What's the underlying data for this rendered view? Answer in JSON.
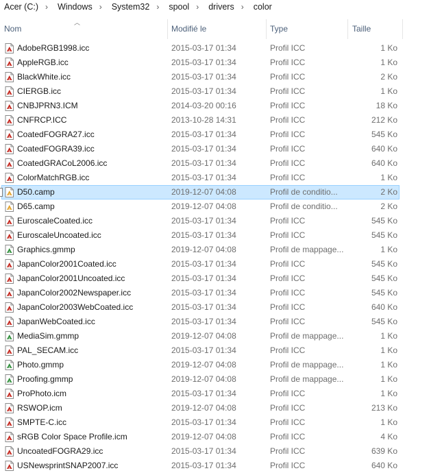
{
  "breadcrumb": [
    "Acer (C:)",
    "Windows",
    "System32",
    "spool",
    "drivers",
    "color"
  ],
  "columns": {
    "name": "Nom",
    "date": "Modifié le",
    "type": "Type",
    "size": "Taille"
  },
  "icon_colors": {
    "icc": "#c4261d",
    "camp": "#e3a22a",
    "gmmp": "#2f8f3a"
  },
  "files": [
    {
      "name": "AdobeRGB1998.icc",
      "date": "2015-03-17 01:34",
      "type": "Profil ICC",
      "size": "1 Ko",
      "icon": "icc-profile-icon"
    },
    {
      "name": "AppleRGB.icc",
      "date": "2015-03-17 01:34",
      "type": "Profil ICC",
      "size": "1 Ko",
      "icon": "icc-profile-icon"
    },
    {
      "name": "BlackWhite.icc",
      "date": "2015-03-17 01:34",
      "type": "Profil ICC",
      "size": "2 Ko",
      "icon": "icc-profile-icon"
    },
    {
      "name": "CIERGB.icc",
      "date": "2015-03-17 01:34",
      "type": "Profil ICC",
      "size": "1 Ko",
      "icon": "icc-profile-icon"
    },
    {
      "name": "CNBJPRN3.ICM",
      "date": "2014-03-20 00:16",
      "type": "Profil ICC",
      "size": "18 Ko",
      "icon": "icc-profile-icon"
    },
    {
      "name": "CNFRCP.ICC",
      "date": "2013-10-28 14:31",
      "type": "Profil ICC",
      "size": "212 Ko",
      "icon": "icc-profile-icon"
    },
    {
      "name": "CoatedFOGRA27.icc",
      "date": "2015-03-17 01:34",
      "type": "Profil ICC",
      "size": "545 Ko",
      "icon": "icc-profile-icon"
    },
    {
      "name": "CoatedFOGRA39.icc",
      "date": "2015-03-17 01:34",
      "type": "Profil ICC",
      "size": "640 Ko",
      "icon": "icc-profile-icon"
    },
    {
      "name": "CoatedGRACoL2006.icc",
      "date": "2015-03-17 01:34",
      "type": "Profil ICC",
      "size": "640 Ko",
      "icon": "icc-profile-icon"
    },
    {
      "name": "ColorMatchRGB.icc",
      "date": "2015-03-17 01:34",
      "type": "Profil ICC",
      "size": "1 Ko",
      "icon": "icc-profile-icon"
    },
    {
      "name": "D50.camp",
      "date": "2019-12-07 04:08",
      "type": "Profil de conditio...",
      "size": "2 Ko",
      "icon": "camp-profile-icon",
      "selected": true
    },
    {
      "name": "D65.camp",
      "date": "2019-12-07 04:08",
      "type": "Profil de conditio...",
      "size": "2 Ko",
      "icon": "camp-profile-icon"
    },
    {
      "name": "EuroscaleCoated.icc",
      "date": "2015-03-17 01:34",
      "type": "Profil ICC",
      "size": "545 Ko",
      "icon": "icc-profile-icon"
    },
    {
      "name": "EuroscaleUncoated.icc",
      "date": "2015-03-17 01:34",
      "type": "Profil ICC",
      "size": "545 Ko",
      "icon": "icc-profile-icon"
    },
    {
      "name": "Graphics.gmmp",
      "date": "2019-12-07 04:08",
      "type": "Profil de mappage...",
      "size": "1 Ko",
      "icon": "gmmp-profile-icon"
    },
    {
      "name": "JapanColor2001Coated.icc",
      "date": "2015-03-17 01:34",
      "type": "Profil ICC",
      "size": "545 Ko",
      "icon": "icc-profile-icon"
    },
    {
      "name": "JapanColor2001Uncoated.icc",
      "date": "2015-03-17 01:34",
      "type": "Profil ICC",
      "size": "545 Ko",
      "icon": "icc-profile-icon"
    },
    {
      "name": "JapanColor2002Newspaper.icc",
      "date": "2015-03-17 01:34",
      "type": "Profil ICC",
      "size": "545 Ko",
      "icon": "icc-profile-icon"
    },
    {
      "name": "JapanColor2003WebCoated.icc",
      "date": "2015-03-17 01:34",
      "type": "Profil ICC",
      "size": "640 Ko",
      "icon": "icc-profile-icon"
    },
    {
      "name": "JapanWebCoated.icc",
      "date": "2015-03-17 01:34",
      "type": "Profil ICC",
      "size": "545 Ko",
      "icon": "icc-profile-icon"
    },
    {
      "name": "MediaSim.gmmp",
      "date": "2019-12-07 04:08",
      "type": "Profil de mappage...",
      "size": "1 Ko",
      "icon": "gmmp-profile-icon"
    },
    {
      "name": "PAL_SECAM.icc",
      "date": "2015-03-17 01:34",
      "type": "Profil ICC",
      "size": "1 Ko",
      "icon": "icc-profile-icon"
    },
    {
      "name": "Photo.gmmp",
      "date": "2019-12-07 04:08",
      "type": "Profil de mappage...",
      "size": "1 Ko",
      "icon": "gmmp-profile-icon"
    },
    {
      "name": "Proofing.gmmp",
      "date": "2019-12-07 04:08",
      "type": "Profil de mappage...",
      "size": "1 Ko",
      "icon": "gmmp-profile-icon"
    },
    {
      "name": "ProPhoto.icm",
      "date": "2015-03-17 01:34",
      "type": "Profil ICC",
      "size": "1 Ko",
      "icon": "icc-profile-icon"
    },
    {
      "name": "RSWOP.icm",
      "date": "2019-12-07 04:08",
      "type": "Profil ICC",
      "size": "213 Ko",
      "icon": "icc-profile-icon"
    },
    {
      "name": "SMPTE-C.icc",
      "date": "2015-03-17 01:34",
      "type": "Profil ICC",
      "size": "1 Ko",
      "icon": "icc-profile-icon"
    },
    {
      "name": "sRGB Color Space Profile.icm",
      "date": "2019-12-07 04:08",
      "type": "Profil ICC",
      "size": "4 Ko",
      "icon": "icc-profile-icon"
    },
    {
      "name": "UncoatedFOGRA29.icc",
      "date": "2015-03-17 01:34",
      "type": "Profil ICC",
      "size": "639 Ko",
      "icon": "icc-profile-icon"
    },
    {
      "name": "USNewsprintSNAP2007.icc",
      "date": "2015-03-17 01:34",
      "type": "Profil ICC",
      "size": "640 Ko",
      "icon": "icc-profile-icon"
    }
  ]
}
